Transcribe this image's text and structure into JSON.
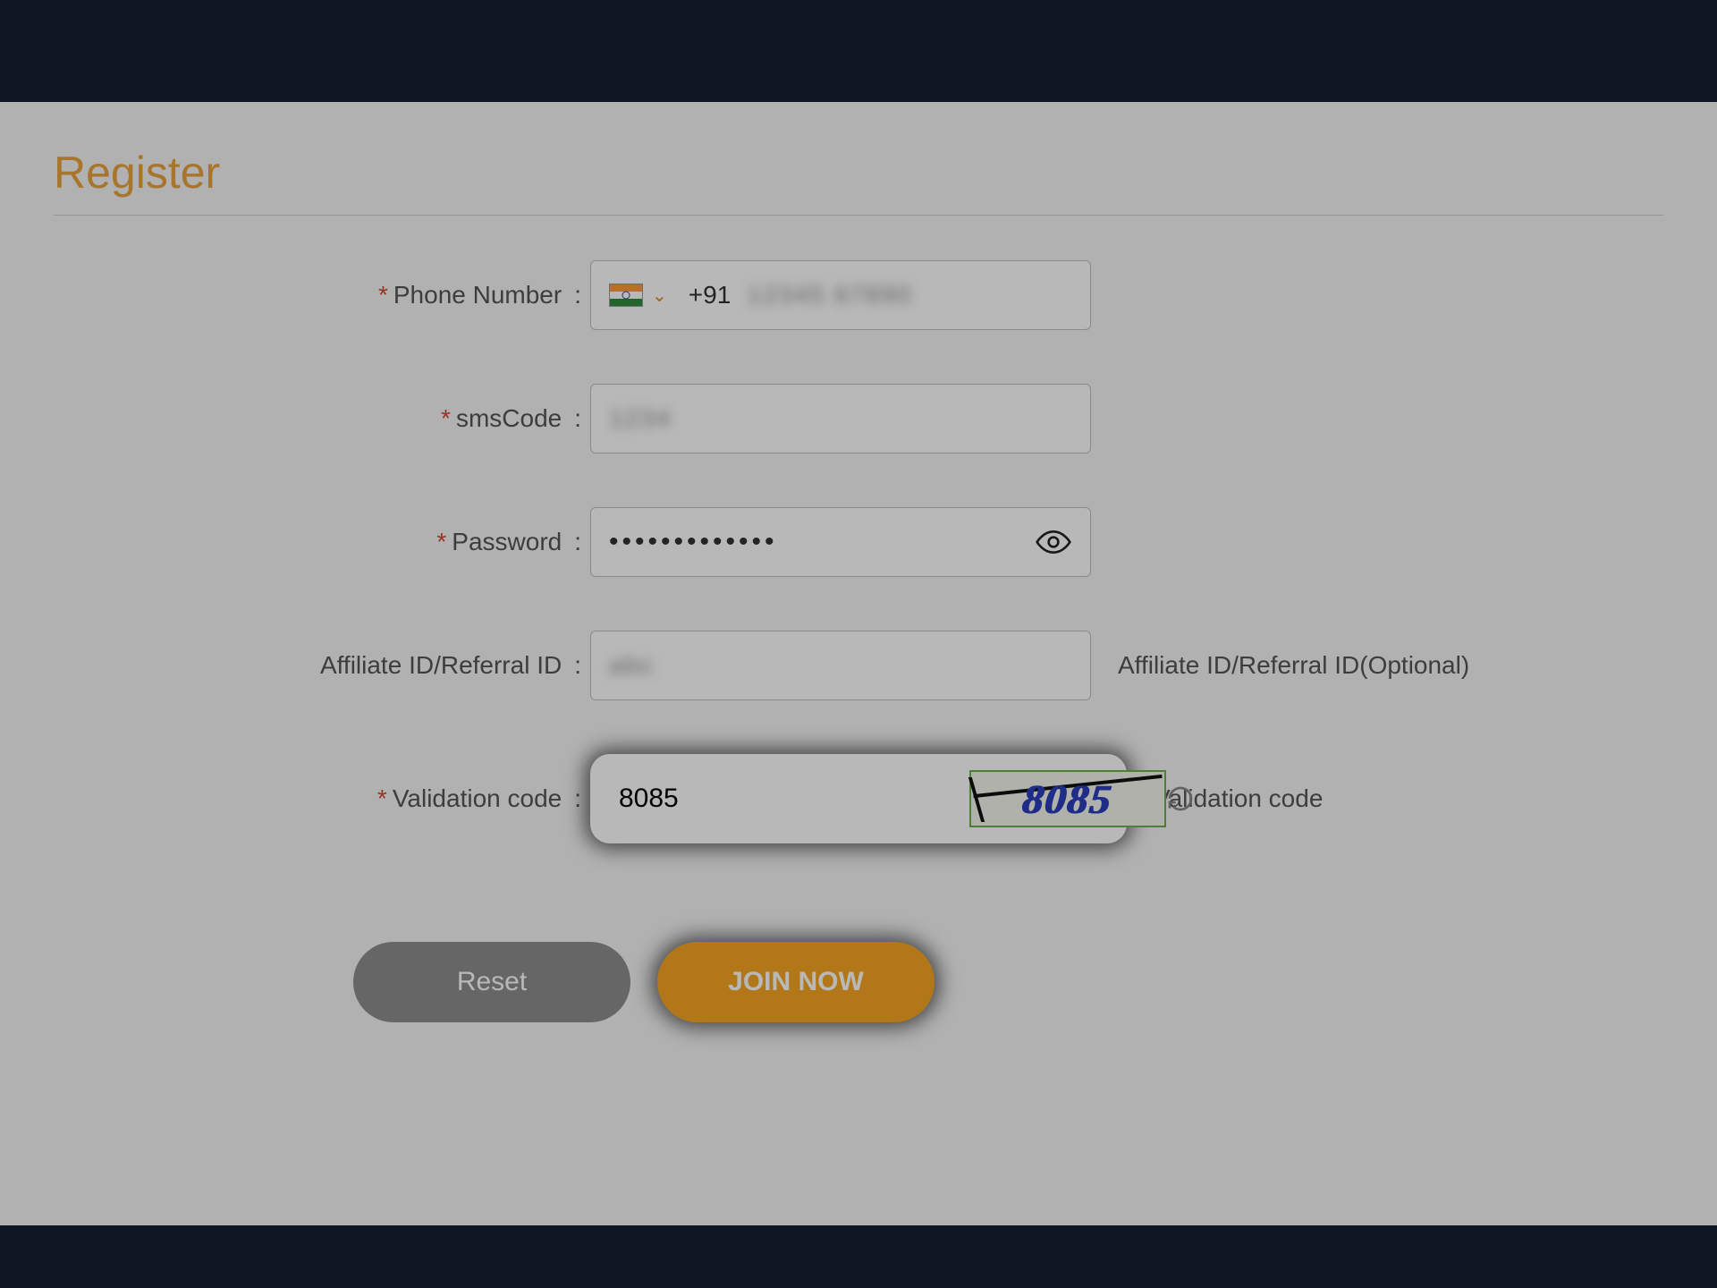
{
  "page": {
    "title": "Register"
  },
  "form": {
    "phone": {
      "label": "Phone Number",
      "prefix": "+91",
      "value_blurred": "12345 67890"
    },
    "smscode": {
      "label": "smsCode",
      "value_blurred": "1234"
    },
    "password": {
      "label": "Password",
      "dots": "•••••••••••••"
    },
    "affiliate": {
      "label": "Affiliate ID/Referral ID",
      "value_blurred": "abc",
      "hint": "Affiliate ID/Referral ID(Optional)"
    },
    "validation": {
      "label": "Validation code",
      "value": "8085",
      "captcha": "8085",
      "hint": "Validation code"
    }
  },
  "buttons": {
    "reset": "Reset",
    "join": "JOIN NOW"
  }
}
